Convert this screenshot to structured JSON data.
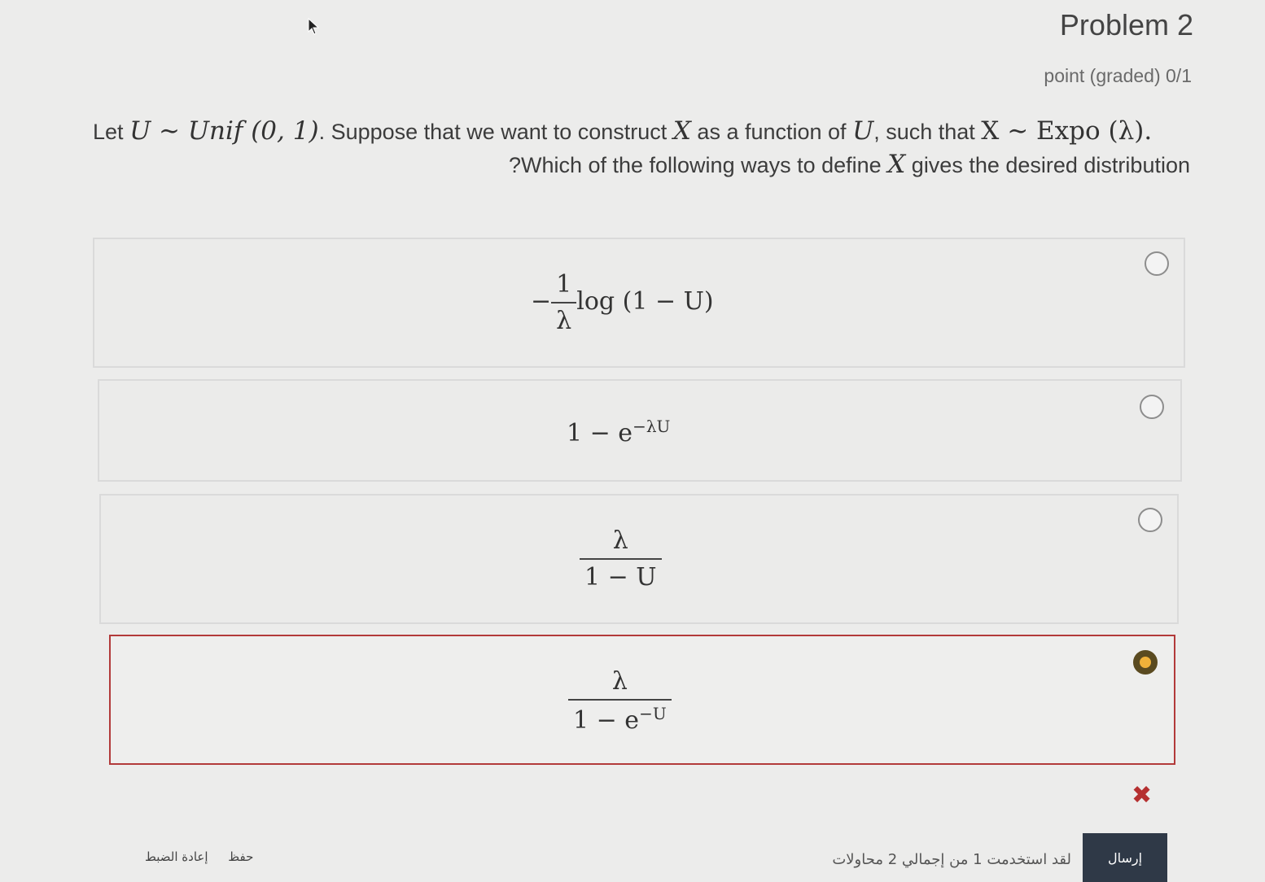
{
  "problem": {
    "title": "Problem 2",
    "points": "point (graded) 0/1"
  },
  "question": {
    "line1_prefix": "Let",
    "line1_math_a": "U ∼ Unif (0, 1)",
    "line1_mid": ". Suppose that we want to construct",
    "line1_math_x": "X",
    "line1_mid2": "as a function of",
    "line1_math_u": "U",
    "line1_mid3": ", such that",
    "line1_math_b": "X ∼ Expo (λ).",
    "line2_prefix": "?Which of the following ways to define",
    "line2_math_x": "X",
    "line2_suffix": "gives the desired distribution"
  },
  "choices": [
    {
      "minus": "−",
      "num": "1",
      "den": "λ",
      "rest": "log (1 − U)",
      "selected": false
    },
    {
      "base": "1 − e",
      "exp": "−λU",
      "selected": false
    },
    {
      "num": "λ",
      "den": "1 − U",
      "selected": false
    },
    {
      "num": "λ",
      "den_base": "1 − e",
      "den_exp": "−U",
      "selected": true
    }
  ],
  "result": {
    "icon": "incorrect-x-icon",
    "symbol": "✖",
    "color": "#b53030"
  },
  "footer": {
    "save_label": "حفظ",
    "reset_label": "إعادة الضبط",
    "attempts_text": "لقد استخدمت 1 من إجمالي 2 محاولات",
    "submit_label": "إرسال"
  }
}
